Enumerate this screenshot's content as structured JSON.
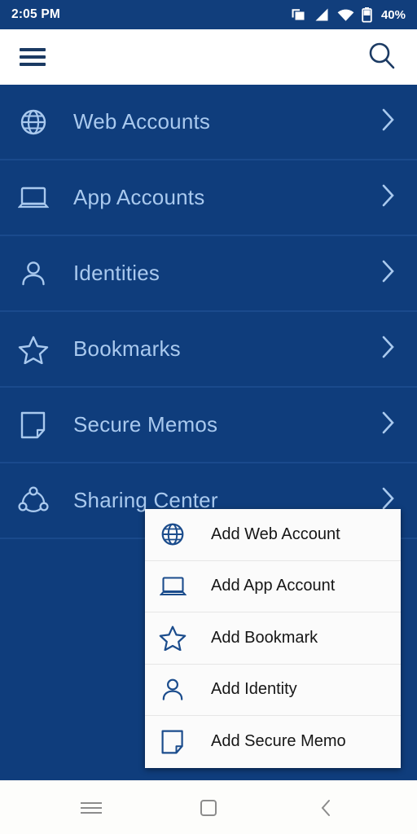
{
  "status_bar": {
    "time": "2:05 PM",
    "battery_percent": "40%",
    "icons": [
      "screen-cast-icon",
      "cellular-signal-icon",
      "wifi-icon",
      "battery-icon"
    ]
  },
  "toolbar": {
    "menu_icon": "hamburger-menu-icon",
    "search_icon": "search-icon",
    "title": ""
  },
  "theme": {
    "background": "#0F3D7C",
    "status_bar_bg": "#113E7C",
    "divider": "#1A4A8C",
    "list_text": "#A9C9EE",
    "list_icon": "#A9C9EE",
    "toolbar_bg": "#FFFFFF",
    "toolbar_icon": "#1B3A63",
    "popup_bg": "#FBFBFB",
    "popup_text": "#161616",
    "popup_icon": "#1B4C8C",
    "popup_divider": "#E6E6E6",
    "navbar_bg": "#FDFDFB",
    "navbar_icon": "#8C8C8C"
  },
  "list": {
    "items": [
      {
        "label": "Web Accounts",
        "icon": "globe-icon",
        "chevron": "chevron-right-icon"
      },
      {
        "label": "App Accounts",
        "icon": "laptop-icon",
        "chevron": "chevron-right-icon"
      },
      {
        "label": "Identities",
        "icon": "person-icon",
        "chevron": "chevron-right-icon"
      },
      {
        "label": "Bookmarks",
        "icon": "star-icon",
        "chevron": "chevron-right-icon"
      },
      {
        "label": "Secure Memos",
        "icon": "memo-icon",
        "chevron": "chevron-right-icon"
      },
      {
        "label": "Sharing Center",
        "icon": "share-icon",
        "chevron": "chevron-right-icon"
      }
    ]
  },
  "popup_menu": {
    "items": [
      {
        "label": "Add Web Account",
        "icon": "globe-icon"
      },
      {
        "label": "Add App Account",
        "icon": "laptop-icon"
      },
      {
        "label": "Add Bookmark",
        "icon": "star-icon"
      },
      {
        "label": "Add Identity",
        "icon": "person-icon"
      },
      {
        "label": "Add Secure Memo",
        "icon": "memo-icon"
      }
    ]
  },
  "nav_bar": {
    "buttons": [
      {
        "name": "recents-button",
        "icon": "menu-lines-icon"
      },
      {
        "name": "home-button",
        "icon": "square-icon"
      },
      {
        "name": "back-button",
        "icon": "chevron-left-icon"
      }
    ]
  }
}
